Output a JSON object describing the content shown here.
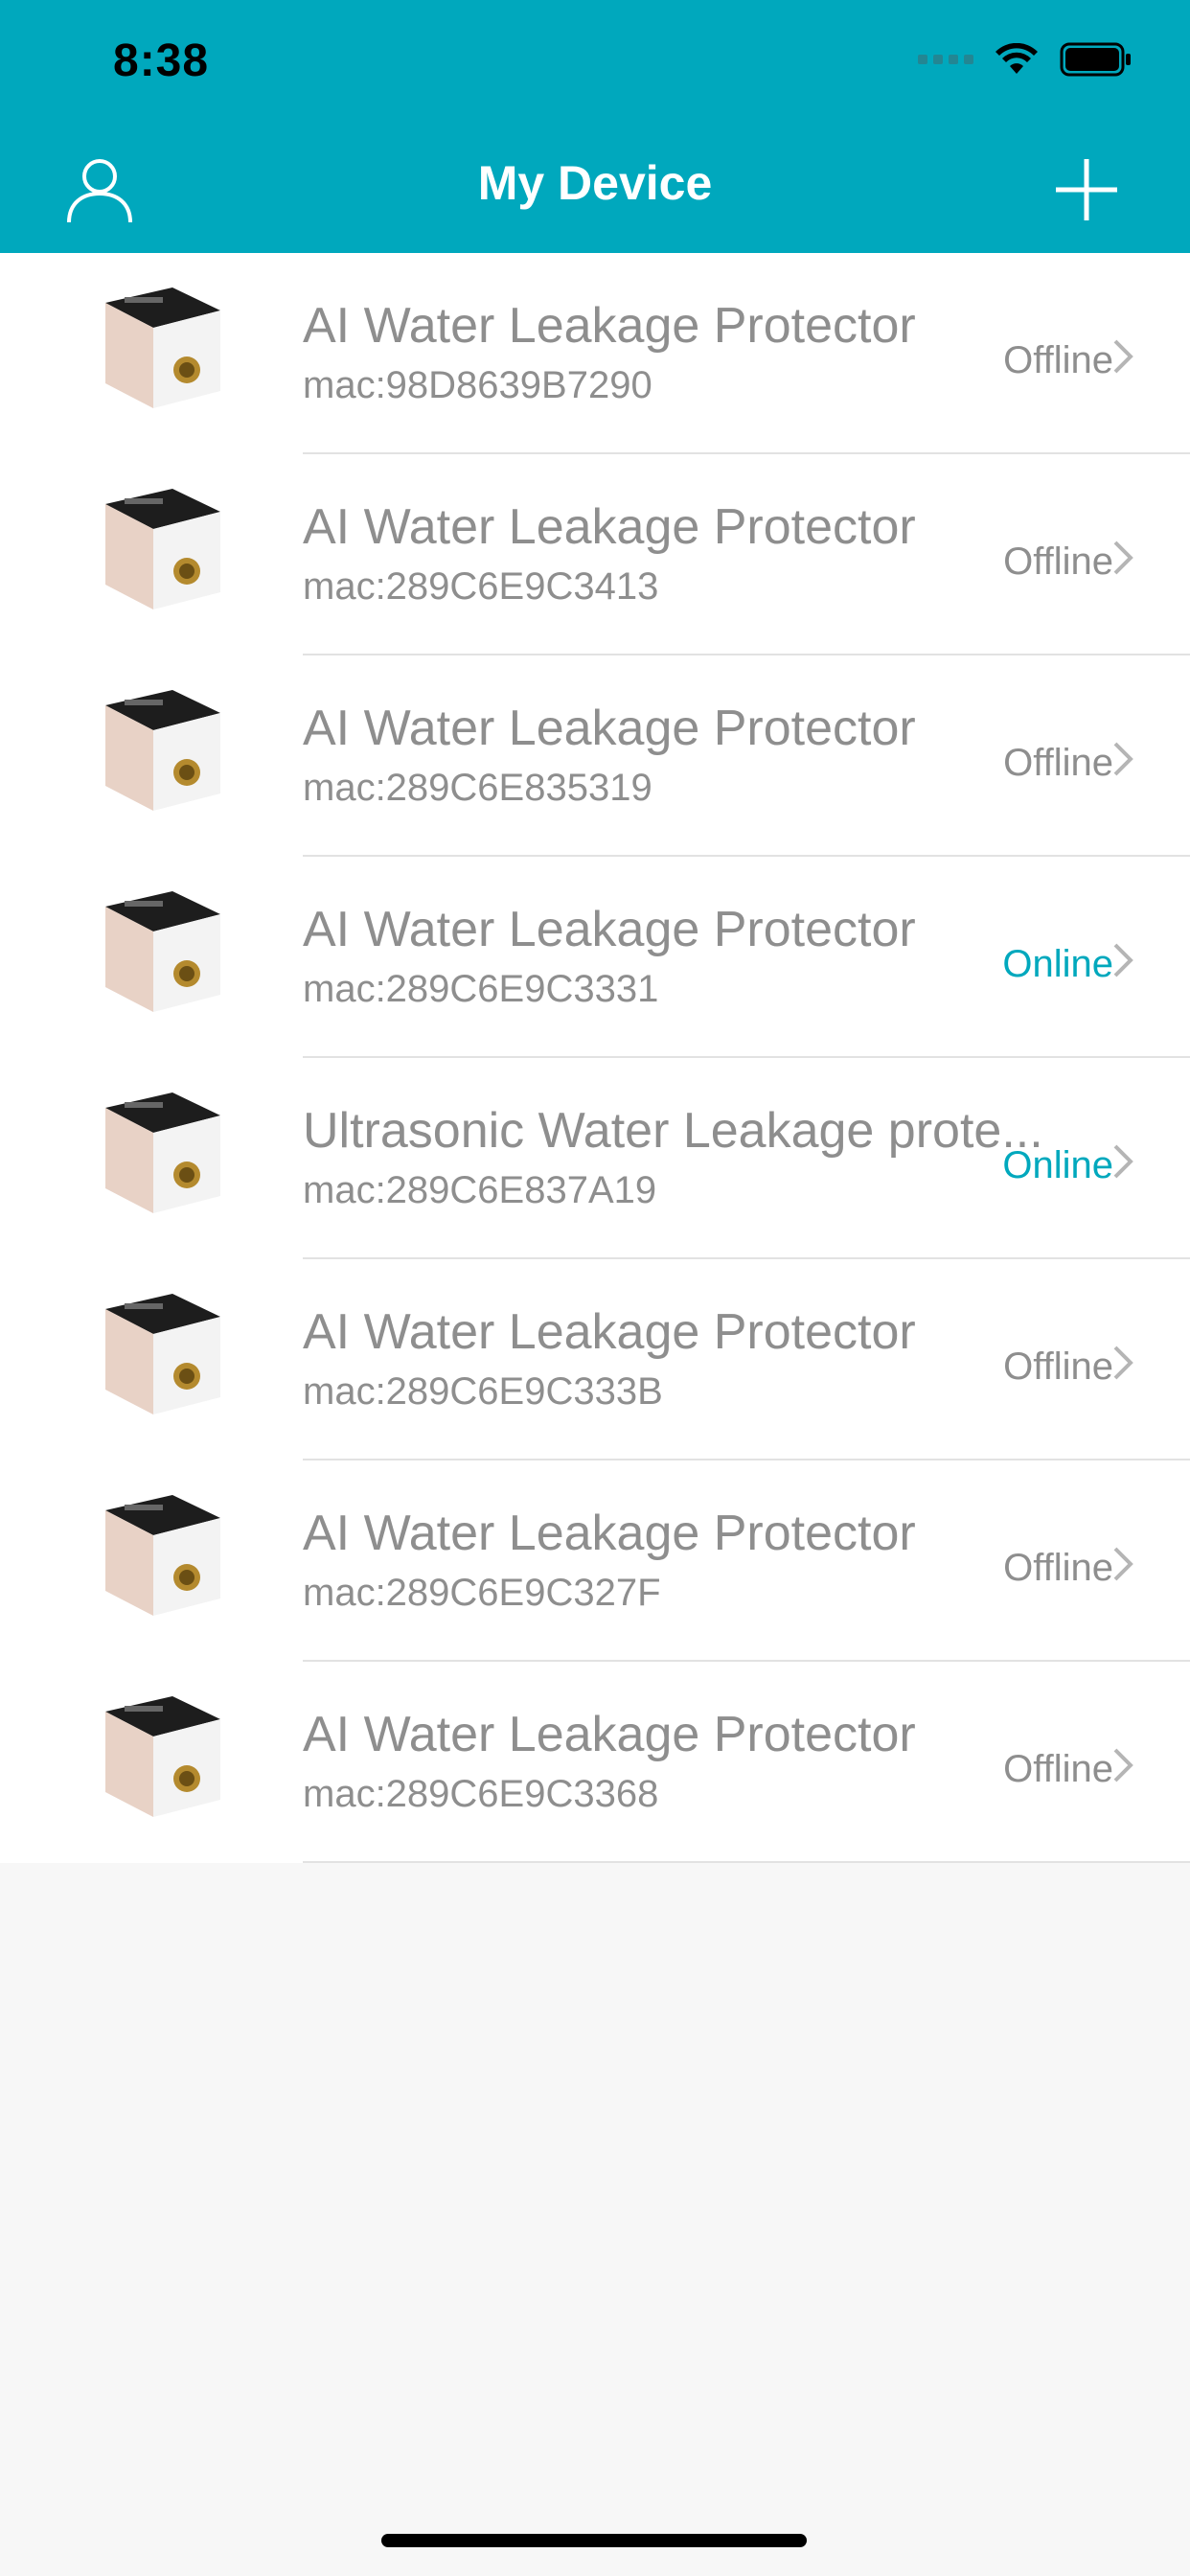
{
  "status_bar": {
    "time": "8:38"
  },
  "header": {
    "title": "My Device",
    "left_icon": "user-icon",
    "right_icon": "plus-icon"
  },
  "colors": {
    "accent": "#00a8bd",
    "text_gray": "#8e8e8e"
  },
  "devices": [
    {
      "name": "AI Water Leakage Protector",
      "mac": "mac:98D8639B7290",
      "status": "Offline"
    },
    {
      "name": "AI Water Leakage Protector",
      "mac": "mac:289C6E9C3413",
      "status": "Offline"
    },
    {
      "name": "AI Water Leakage Protector",
      "mac": "mac:289C6E835319",
      "status": "Offline"
    },
    {
      "name": "AI Water Leakage Protector",
      "mac": "mac:289C6E9C3331",
      "status": "Online"
    },
    {
      "name": "Ultrasonic Water Leakage prote...",
      "mac": "mac:289C6E837A19",
      "status": "Online"
    },
    {
      "name": "AI Water Leakage Protector",
      "mac": "mac:289C6E9C333B",
      "status": "Offline"
    },
    {
      "name": "AI Water Leakage Protector",
      "mac": "mac:289C6E9C327F",
      "status": "Offline"
    },
    {
      "name": "AI Water Leakage Protector",
      "mac": "mac:289C6E9C3368",
      "status": "Offline"
    }
  ]
}
